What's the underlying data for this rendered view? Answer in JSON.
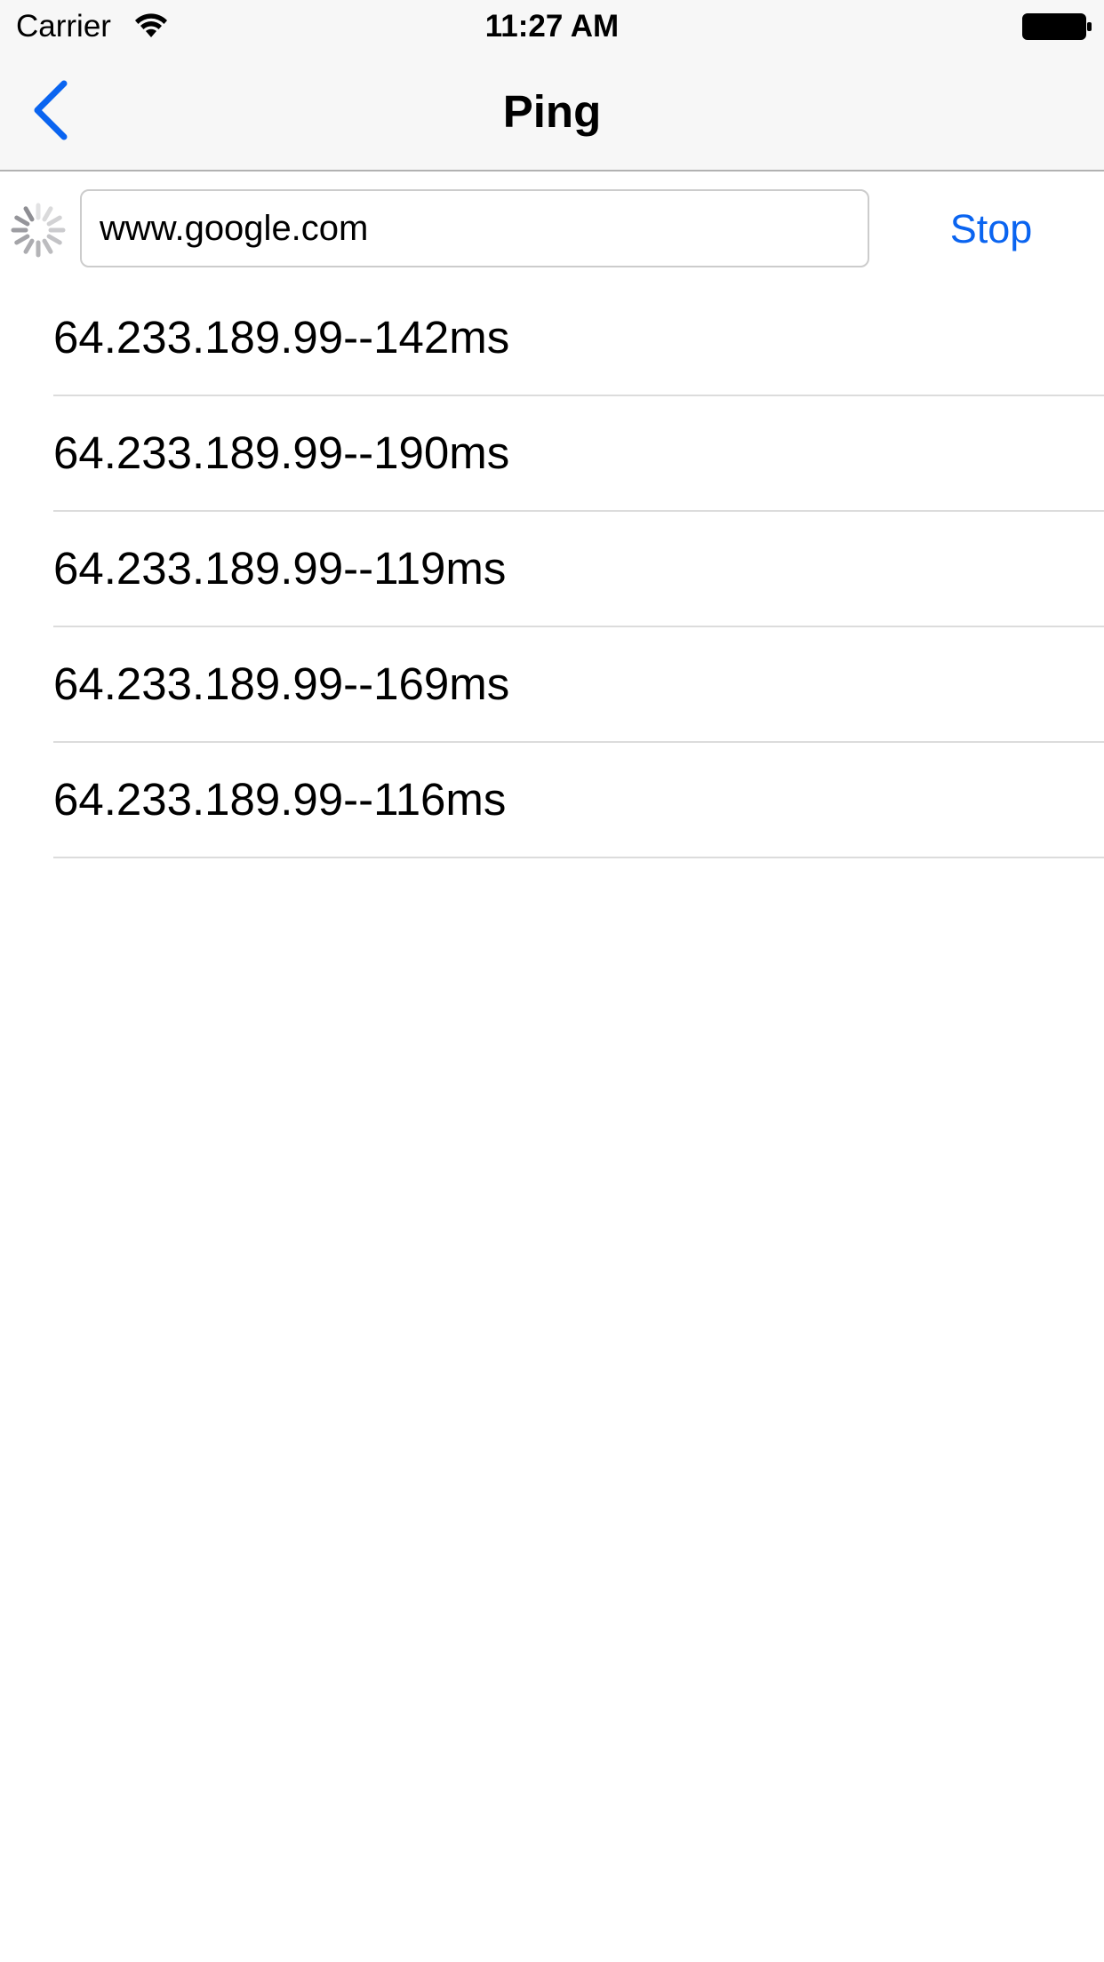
{
  "status_bar": {
    "carrier": "Carrier",
    "time": "11:27 AM"
  },
  "nav": {
    "title": "Ping",
    "back_icon": "chevron-left-icon"
  },
  "ping_form": {
    "host_value": "www.google.com",
    "stop_label": "Stop",
    "activity_icon": "spinner-icon"
  },
  "results": [
    "64.233.189.99--142ms",
    "64.233.189.99--190ms",
    "64.233.189.99--119ms",
    "64.233.189.99--169ms",
    "64.233.189.99--116ms"
  ],
  "colors": {
    "accent": "#0a64f0",
    "bar_background": "#f7f7f7",
    "separator": "#dcdcdc"
  }
}
